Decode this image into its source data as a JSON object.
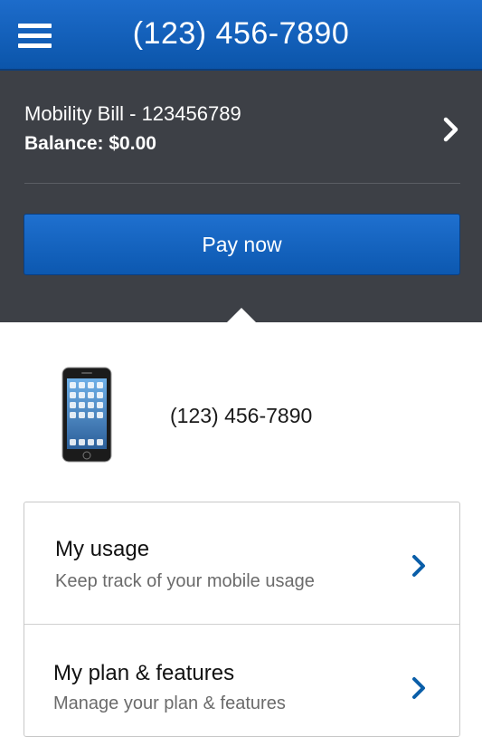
{
  "header": {
    "title": "(123) 456-7890",
    "menu_icon": "hamburger-menu-icon"
  },
  "bill": {
    "name": "Mobility Bill - 123456789",
    "balance": "Balance: $0.00",
    "pay_label": "Pay now"
  },
  "device": {
    "number": "(123) 456-7890",
    "image": "smartphone-image"
  },
  "cards": [
    {
      "title": "My usage",
      "subtitle": "Keep track of your mobile usage"
    },
    {
      "title": "My plan & features",
      "subtitle": "Manage your plan & features"
    }
  ],
  "colors": {
    "header_blue": "#0b55aa",
    "panel_gray": "#3d4046",
    "chevron_blue": "#0a5ea8"
  }
}
